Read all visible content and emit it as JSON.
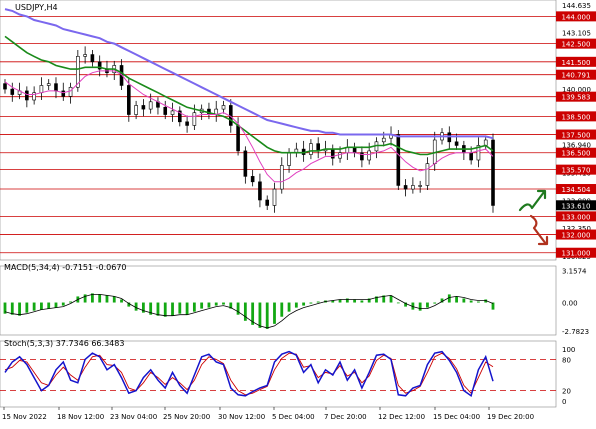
{
  "header": {
    "symbol_label": "USDJPY,H4",
    "macd_label": "MACD(5,34,4) -0.7151 -0.0670",
    "stoch_label": "Stoch(5,3,3) 37.7346 66.3483"
  },
  "colors": {
    "bull_candle": "#000000",
    "bear_candle": "#000000",
    "ma_fast": "#e040c0",
    "ma_mid": "#1a8a1a",
    "ma_slow": "#7b68ee",
    "level_line": "#cc0000",
    "macd_hist": "#13a813",
    "macd_signal": "#000000",
    "stoch_main": "#1414cc",
    "stoch_signal": "#cc0000",
    "arrow_up": "#1f7a1f",
    "arrow_down": "#b0321e"
  },
  "chart_data": [
    {
      "type": "candlestick",
      "title": "USDJPY,H4",
      "price_axis_ticks": [
        "144.635",
        "143.105",
        "141.580",
        "140.000",
        "138.500",
        "136.940",
        "135.410",
        "133.880",
        "132.350",
        "130.825"
      ],
      "ylim": [
        130.6,
        144.9
      ],
      "levels": [
        {
          "label": "144.000",
          "value": 144.0
        },
        {
          "label": "142.500",
          "value": 142.5
        },
        {
          "label": "141.500",
          "value": 141.5
        },
        {
          "label": "140.791",
          "value": 140.791
        },
        {
          "label": "139.583",
          "value": 139.583
        },
        {
          "label": "138.500",
          "value": 138.5
        },
        {
          "label": "137.500",
          "value": 137.5
        },
        {
          "label": "136.500",
          "value": 136.5
        },
        {
          "label": "135.570",
          "value": 135.57
        },
        {
          "label": "134.504",
          "value": 134.504
        },
        {
          "label": "133.000",
          "value": 133.0
        },
        {
          "label": "132.000",
          "value": 132.0
        },
        {
          "label": "131.000",
          "value": 131.0
        }
      ],
      "current_price_label": "133.610",
      "current_price": 133.61,
      "x_labels": [
        "15 Nov 2022",
        "18 Nov 12:00",
        "23 Nov 04:00",
        "25 Nov 20:00",
        "30 Nov 12:00",
        "5 Dec 04:00",
        "7 Dec 20:00",
        "12 Dec 12:00",
        "15 Dec 04:00",
        "19 Dec 20:00"
      ],
      "close": [
        140.0,
        139.7,
        139.9,
        139.4,
        139.8,
        140.2,
        140.3,
        139.9,
        139.6,
        140.1,
        141.8,
        141.9,
        141.5,
        141.1,
        140.9,
        141.3,
        140.2,
        138.6,
        139.1,
        138.9,
        139.3,
        139.0,
        138.6,
        138.8,
        138.2,
        138.0,
        138.7,
        138.9,
        138.6,
        138.9,
        139.1,
        138.0,
        136.6,
        135.2,
        134.9,
        133.9,
        133.6,
        134.5,
        135.8,
        136.5,
        136.7,
        136.4,
        137.0,
        136.6,
        136.7,
        136.2,
        136.5,
        136.8,
        136.5,
        136.1,
        136.6,
        137.1,
        137.3,
        137.5,
        134.7,
        134.5,
        134.7,
        134.7,
        135.9,
        137.2,
        137.6,
        137.1,
        136.9,
        136.5,
        136.1,
        136.9,
        137.2,
        133.6
      ],
      "ma_fast": [
        140.4,
        140.1,
        139.9,
        139.7,
        139.7,
        139.8,
        139.9,
        139.9,
        139.8,
        139.9,
        140.3,
        140.7,
        140.9,
        141.0,
        141.0,
        141.0,
        140.8,
        140.3,
        140.0,
        139.7,
        139.5,
        139.3,
        139.1,
        138.9,
        138.7,
        138.5,
        138.5,
        138.6,
        138.6,
        138.6,
        138.7,
        138.5,
        138.1,
        137.5,
        136.8,
        136.0,
        135.3,
        134.9,
        134.9,
        135.1,
        135.4,
        135.6,
        135.9,
        136.1,
        136.3,
        136.3,
        136.4,
        136.5,
        136.5,
        136.4,
        136.4,
        136.5,
        136.6,
        136.8,
        136.4,
        136.0,
        135.7,
        135.5,
        135.6,
        135.9,
        136.2,
        136.4,
        136.5,
        136.5,
        136.5,
        136.6,
        136.7,
        136.3
      ],
      "ma_mid": [
        142.9,
        142.6,
        142.3,
        142.0,
        141.8,
        141.6,
        141.5,
        141.3,
        141.2,
        141.1,
        141.1,
        141.2,
        141.2,
        141.2,
        141.1,
        141.1,
        140.9,
        140.6,
        140.4,
        140.2,
        140.0,
        139.8,
        139.6,
        139.4,
        139.2,
        139.0,
        138.9,
        138.8,
        138.7,
        138.6,
        138.5,
        138.3,
        138.0,
        137.7,
        137.4,
        137.1,
        136.8,
        136.6,
        136.5,
        136.5,
        136.5,
        136.5,
        136.6,
        136.6,
        136.7,
        136.7,
        136.7,
        136.8,
        136.8,
        136.8,
        136.8,
        136.9,
        136.9,
        137.0,
        136.8,
        136.6,
        136.5,
        136.4,
        136.4,
        136.5,
        136.6,
        136.7,
        136.7,
        136.7,
        136.7,
        136.8,
        136.9,
        136.6
      ],
      "ma_slow": [
        144.4,
        144.3,
        144.1,
        144.0,
        143.8,
        143.7,
        143.6,
        143.5,
        143.3,
        143.2,
        143.1,
        143.0,
        142.9,
        142.8,
        142.6,
        142.5,
        142.3,
        142.1,
        141.9,
        141.7,
        141.5,
        141.3,
        141.1,
        140.9,
        140.7,
        140.5,
        140.3,
        140.1,
        139.9,
        139.7,
        139.5,
        139.3,
        139.1,
        138.9,
        138.7,
        138.5,
        138.3,
        138.2,
        138.1,
        138.0,
        137.9,
        137.8,
        137.7,
        137.7,
        137.6,
        137.6,
        137.5,
        137.5,
        137.5,
        137.5,
        137.5,
        137.5,
        137.5,
        137.5,
        137.4,
        137.4,
        137.4,
        137.4,
        137.4,
        137.4,
        137.4,
        137.4,
        137.4,
        137.4,
        137.4,
        137.4,
        137.4,
        137.3
      ]
    },
    {
      "type": "bar",
      "title": "MACD(5,34,4) -0.7151 -0.0670",
      "y_ticks": [
        "3.1574",
        "0.00",
        "-2.7823"
      ],
      "ylim": [
        -3.2,
        3.6
      ],
      "values": [
        -1.1,
        -1.2,
        -1.3,
        -1.0,
        -0.8,
        -0.7,
        -0.6,
        -0.5,
        -0.3,
        0.1,
        0.6,
        0.8,
        0.9,
        0.8,
        0.7,
        0.6,
        0.3,
        -0.4,
        -0.8,
        -1.0,
        -1.2,
        -1.3,
        -1.4,
        -1.3,
        -1.1,
        -1.2,
        -0.9,
        -0.6,
        -0.5,
        -0.3,
        -0.2,
        -0.6,
        -1.2,
        -1.8,
        -2.2,
        -2.5,
        -2.6,
        -2.1,
        -1.4,
        -0.9,
        -0.5,
        -0.3,
        -0.1,
        0.1,
        0.2,
        0.2,
        0.3,
        0.4,
        0.3,
        0.2,
        0.4,
        0.6,
        0.7,
        0.7,
        0.0,
        -0.4,
        -0.7,
        -0.8,
        -0.5,
        -0.1,
        0.4,
        0.8,
        0.6,
        0.4,
        0.2,
        0.1,
        0.3,
        -0.7
      ],
      "signal": [
        -0.9,
        -1.1,
        -1.2,
        -1.1,
        -0.9,
        -0.7,
        -0.6,
        -0.5,
        -0.4,
        -0.1,
        0.3,
        0.6,
        0.8,
        0.8,
        0.7,
        0.6,
        0.4,
        -0.1,
        -0.5,
        -0.8,
        -1.0,
        -1.2,
        -1.3,
        -1.3,
        -1.2,
        -1.2,
        -1.0,
        -0.8,
        -0.6,
        -0.4,
        -0.3,
        -0.5,
        -0.9,
        -1.4,
        -1.9,
        -2.3,
        -2.5,
        -2.3,
        -1.8,
        -1.2,
        -0.8,
        -0.5,
        -0.3,
        -0.1,
        0.1,
        0.2,
        0.3,
        0.3,
        0.3,
        0.3,
        0.3,
        0.5,
        0.6,
        0.7,
        0.3,
        -0.1,
        -0.4,
        -0.6,
        -0.6,
        -0.3,
        0.1,
        0.5,
        0.6,
        0.5,
        0.3,
        0.2,
        0.2,
        -0.1
      ]
    },
    {
      "type": "line",
      "title": "Stoch(5,3,3) 37.7346 66.3483",
      "y_ticks": [
        "100",
        "80",
        "20",
        "0"
      ],
      "levels": [
        80,
        20
      ],
      "ylim": [
        0,
        100
      ],
      "series": [
        {
          "values": [
            55,
            75,
            85,
            70,
            45,
            20,
            30,
            60,
            75,
            40,
            35,
            80,
            92,
            85,
            60,
            70,
            45,
            15,
            20,
            45,
            60,
            40,
            25,
            55,
            30,
            15,
            50,
            85,
            90,
            75,
            70,
            25,
            12,
            10,
            18,
            25,
            30,
            75,
            90,
            95,
            88,
            55,
            70,
            35,
            60,
            50,
            75,
            40,
            60,
            25,
            55,
            88,
            90,
            80,
            12,
            10,
            25,
            30,
            70,
            92,
            95,
            78,
            55,
            20,
            10,
            60,
            85,
            38
          ]
        },
        {
          "values": [
            60,
            65,
            78,
            75,
            55,
            35,
            30,
            50,
            65,
            50,
            40,
            65,
            85,
            88,
            70,
            68,
            55,
            25,
            20,
            35,
            55,
            45,
            32,
            45,
            35,
            22,
            40,
            70,
            85,
            80,
            72,
            40,
            20,
            12,
            15,
            22,
            28,
            60,
            82,
            92,
            90,
            65,
            68,
            45,
            55,
            52,
            68,
            48,
            55,
            35,
            48,
            78,
            88,
            82,
            30,
            15,
            20,
            28,
            55,
            85,
            92,
            82,
            62,
            30,
            15,
            45,
            75,
            66
          ]
        }
      ]
    }
  ]
}
